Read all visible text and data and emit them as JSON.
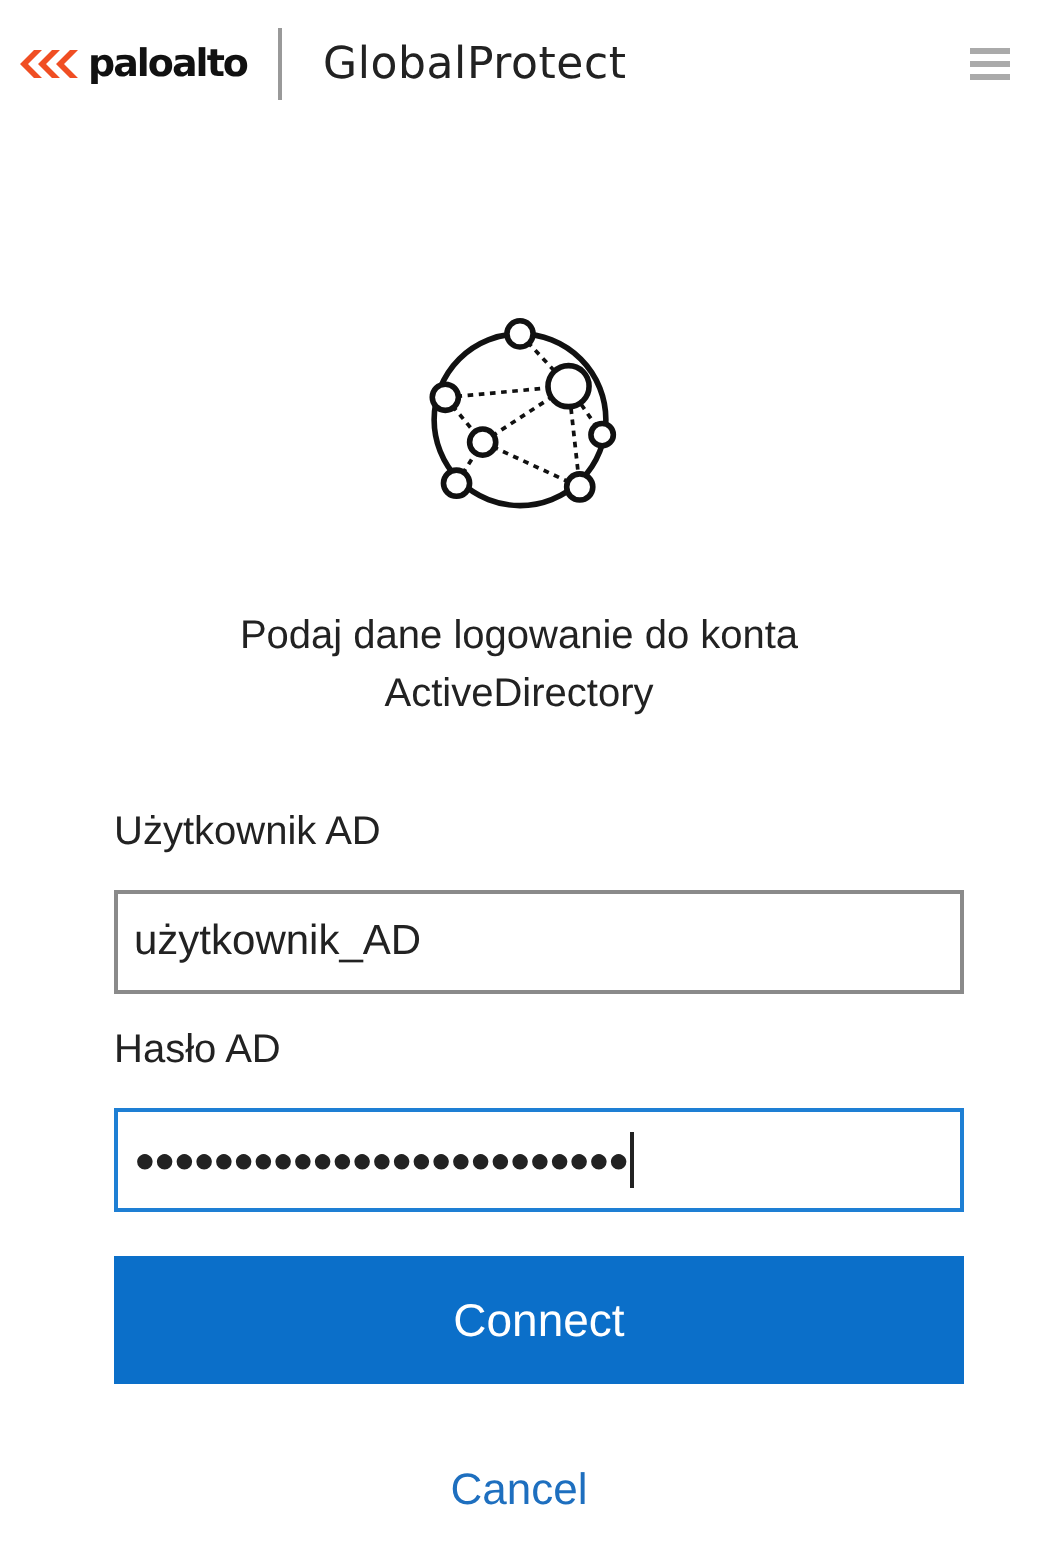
{
  "header": {
    "brand": "paloalto",
    "product": "GlobalProtect"
  },
  "prompt": "Podaj dane logowanie do konta ActiveDirectory",
  "fields": [
    {
      "kind": "text",
      "label": "Użytkownik AD",
      "value": "użytkownik_AD",
      "focused": false
    },
    {
      "kind": "password",
      "label": "Hasło AD",
      "value": "●●●●●●●●●●●●●●●●●●●●●●●●●",
      "focused": true
    }
  ],
  "buttons": [
    {
      "kind": "primary",
      "label": "Connect"
    },
    {
      "kind": "link",
      "label": "Cancel"
    }
  ]
}
